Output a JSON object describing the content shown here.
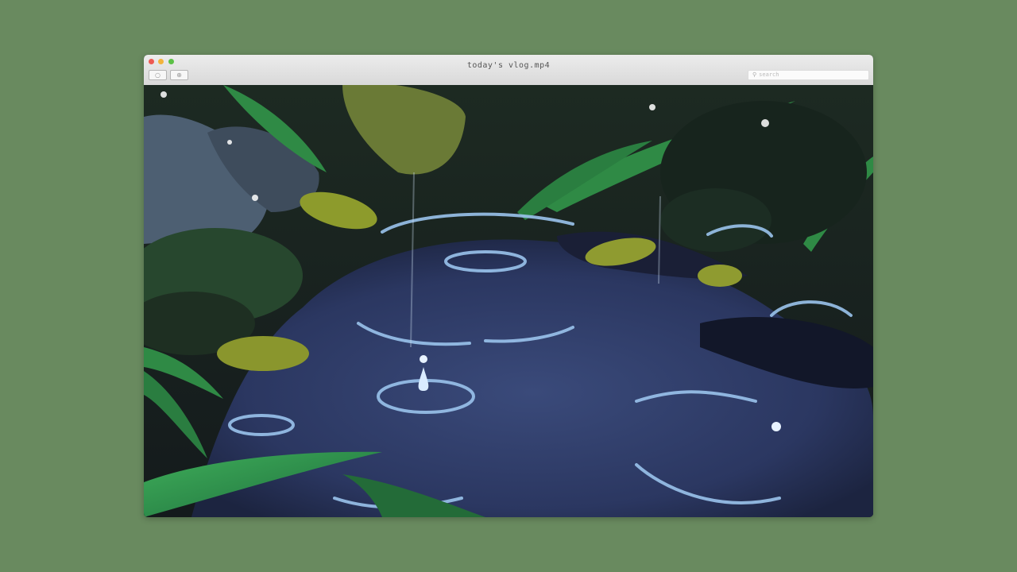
{
  "window": {
    "title": "today's vlog.mp4",
    "controls": [
      "close",
      "minimize",
      "zoom"
    ]
  },
  "toolbar": {
    "buttons": [
      {
        "icon": "circle-icon"
      },
      {
        "icon": "plus-circle-icon"
      }
    ]
  },
  "search": {
    "placeholder": "search",
    "icon": "search-icon"
  },
  "colors": {
    "background": "#698a5f",
    "titlebar": "#e4e4e4",
    "close": "#ee5a52",
    "minimize": "#f3b43c",
    "zoom": "#5cc146"
  }
}
